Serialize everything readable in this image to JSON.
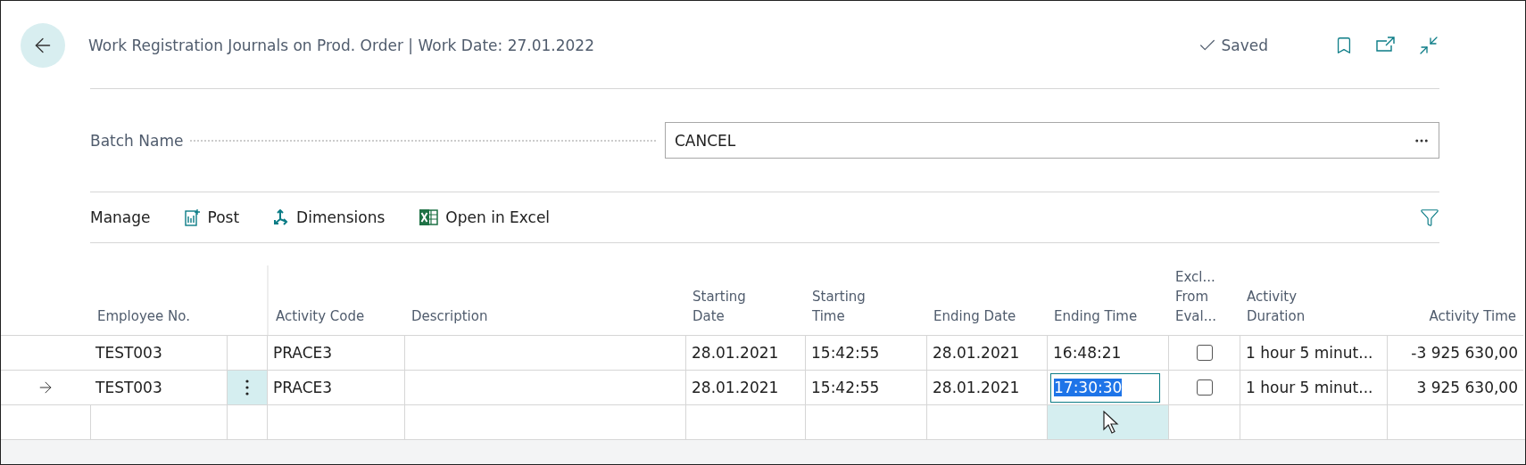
{
  "header": {
    "title": "Work Registration Journals on Prod. Order | Work Date: 27.01.2022",
    "status": "Saved"
  },
  "batch": {
    "label": "Batch Name",
    "value": "CANCEL"
  },
  "actions": [
    {
      "kind": "menu",
      "label": "Manage"
    },
    {
      "kind": "post",
      "label": "Post"
    },
    {
      "kind": "dimensions",
      "label": "Dimensions"
    },
    {
      "kind": "excel",
      "label": "Open in Excel"
    }
  ],
  "columns": [
    "Employee No.",
    "Activity Code",
    "Description",
    "Starting\nDate",
    "Starting\nTime",
    "Ending Date",
    "Ending Time",
    "Excl...\nFrom\nEval...",
    "Activity\nDuration",
    "Activity Time"
  ],
  "rows": [
    {
      "selected": false,
      "editing": false,
      "employee_no": "TEST003",
      "activity_code": "PRACE3",
      "starting_date": "28.01.2021",
      "starting_time": "15:42:55",
      "ending_date": "28.01.2021",
      "ending_time": "16:48:21",
      "excluded": false,
      "activity_duration": "1 hour 5 minut...",
      "activity_time": "-3 925 630,00"
    },
    {
      "selected": true,
      "editing": true,
      "employee_no": "TEST003",
      "activity_code": "PRACE3",
      "starting_date": "28.01.2021",
      "starting_time": "15:42:55",
      "ending_date": "28.01.2021",
      "ending_time": "17:30:30",
      "excluded": false,
      "activity_duration": "1 hour 5 minut...",
      "activity_time": "3 925 630,00"
    }
  ],
  "new_row": {
    "ending_time_hovered": true
  }
}
